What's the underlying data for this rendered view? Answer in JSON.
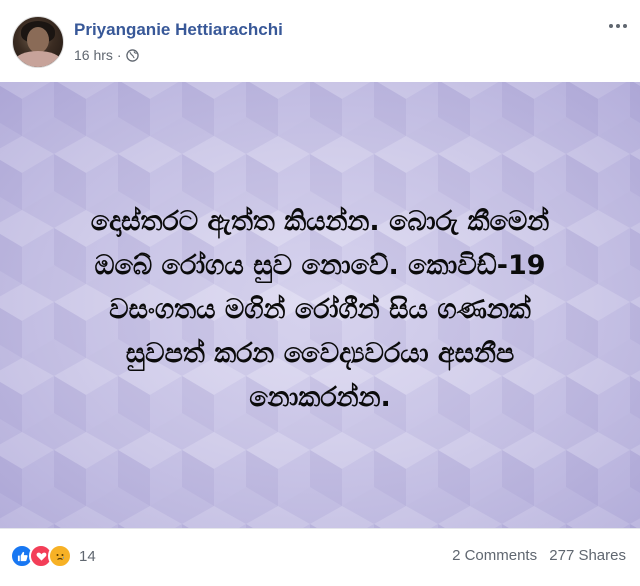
{
  "post": {
    "author": "Priyanganie Hettiarachchi",
    "time": "16 hrs",
    "separator": "·",
    "privacy_icon": "globe-icon",
    "more_icon": "more-options-icon"
  },
  "image_text": {
    "lines": [
      "දොස්තරට ඇත්ත කියන්න. බොරු කීමෙන්",
      "ඔබේ රෝගය සුව නොවේ. කොවිඩ්-19",
      "වසංගතය මගින් රෝගීන් සිය ගණනක්",
      "සුවපත් කරන වෛද්‍යවරයා අසනීප",
      "නොකරන්න."
    ],
    "background_color": "#c7c2e6",
    "text_color": "#0b0b0b"
  },
  "footer": {
    "reaction_icons": [
      "like-icon",
      "love-icon",
      "sad-icon"
    ],
    "reaction_count": "14",
    "comments": "2 Comments",
    "shares": "277 Shares"
  },
  "colors": {
    "link": "#385898",
    "meta": "#606770",
    "like": "#1877f2",
    "love": "#f33e58",
    "sad": "#f7b125"
  }
}
